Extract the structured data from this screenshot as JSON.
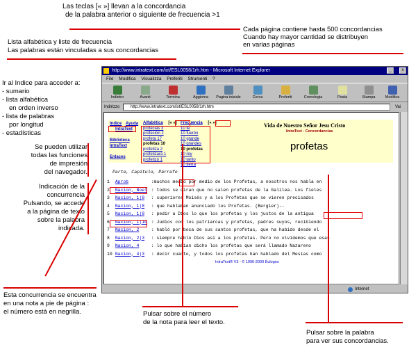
{
  "annotations": {
    "top1": "Las teclas [« »] llevan a la  concordancia",
    "top2": "de la palabra anterior o siguiente  de frecuencia >1",
    "right1": "Cada página contiene hasta 500 concordancias",
    "right2": "Cuando hay mayor cantidad se distribuyen",
    "right3": "en varias páginas",
    "lista1": "Lista alfabética y liste de frecuencia",
    "lista2": "Las palabras están vinculadas a sus concordancias",
    "indice": [
      "Ir al Indice para acceder a:",
      " - sumario",
      " - lista alfabética",
      "   en orden inverso",
      " - lista de palabras",
      "   por longitud",
      " - estadísticas"
    ],
    "funciones": [
      "Se pueden utilizar",
      "todas las funciones",
      "de impresión",
      "del navegador."
    ],
    "indicacion": [
      "Indicación de la",
      "concurrencia",
      "Pulsando, se accede",
      "a la página de texto",
      "sobre la  palabra",
      "indicada."
    ],
    "nota": [
      "Esta concurrencia se encuentra",
      "en una nota a pie de página :",
      "el número está en negrilla."
    ],
    "pulsar_num": [
      "Pulsar sobre el número",
      "de la nota para leer el texto."
    ],
    "pulsar_pal": [
      "Pulsar sobre la palabra",
      "para ver sus concordancias."
    ]
  },
  "browser": {
    "title": "http://www.intratext.com/ixt/ESL0058/1rh.htm - Microsoft Internet Explorer",
    "menu": [
      "File",
      "Modifica",
      "Visualizza",
      "Preferiti",
      "Strumenti",
      "?"
    ],
    "toolbar": [
      "Indietro",
      "Avanti",
      "Termina",
      "Aggiorna",
      "Pagina iniziale",
      "Cerca",
      "Preferiti",
      "Cronologia",
      "Posta",
      "Stampa",
      "Modifica"
    ],
    "address_label": "Indirizzo",
    "address": "http://www.intratext.com/ixt/ESL0058/1rh.htm",
    "go": "Vai",
    "status_left": "",
    "status_right": "Internet"
  },
  "header": {
    "indice": "Indice",
    "ayuda": "Ayuda",
    "intratext": "IntraText",
    "biblioteca": "Biblioteca",
    "intratext2": "IntraText",
    "enlaces": "Enlaces",
    "alfabetica": "Alfabética",
    "alfa_nav": "[« »]",
    "frecuencia": "Frecuencia",
    "frec_nav": "[« »]",
    "alfa_list": [
      "profecias  3",
      "profeción  2",
      "profeta  17",
      "profetas  10",
      "profetiza  2",
      "profetizará  1",
      "profetizó  1"
    ],
    "frec_list": [
      "10  fe",
      "10  fuerón",
      "10  grande",
      "10  grandes",
      "10  profetas",
      "10  rey",
      "10  tanto",
      "10  tierra"
    ],
    "book_title": "Vida de Nuestro Señor Jesu Cristo",
    "sub": "IntraText - Concordancias",
    "word": "profetas"
  },
  "section_label": "Parte, Capítulo, Párrafo",
  "rows": [
    {
      "n": "1",
      "loc": "Aprob",
      "text": ":muchos medio  por medio  de los Profetas, a nosotros nos  habla  en"
    },
    {
      "n": "2",
      "loc": "Nacion, Noel",
      "text": ":  todos se  diran  que no  salen  profetas de la  Galilea.  Los  fieles"
    },
    {
      "n": "3",
      "loc": "Nacion, 1|8",
      "text": ":     superiores  Moisés y a los  Profetas que se  vieren  precisados"
    },
    {
      "n": "4",
      "loc": "Nacion, 1|8",
      "text": ":     que  hablaban  anunciado  los  Profetas.  (Bergier)--"
    },
    {
      "n": "5",
      "loc": "Nacion, 1|8",
      "text": ":     pedir a  Dios  lo que los  profetas y los  justos  de la  antigua"
    },
    {
      "n": "6",
      "loc": "Nacion, 1|10",
      "text": ":  Judios  con los  patriarcas y  profetas, padres  suyos,  recibiendo"
    },
    {
      "n": "7",
      "loc": "Nacion, 2",
      "text": ":  habló  por  boca  de sus  santos  profetas,  que  ha  habido  desde  el"
    },
    {
      "n": "8",
      "loc": "Nacion, 2|3",
      "text": ":  siempre  hablo  Dios  así a los  profetas.  Pero no  olvidemos  que  esas"
    },
    {
      "n": "9",
      "loc": "Nacion, 4",
      "text": ":     lo que  habían  dicho  los  profetas que  será  llamado  Nazareno"
    },
    {
      "n": "10",
      "loc": "Nacion, 4|3",
      "text": ":     decir  cuanto, y todos los  profetas  han  hablado  del  Mesías  como"
    }
  ],
  "footer": "IntraText® V3 - © 1996-2000  Éulogos"
}
